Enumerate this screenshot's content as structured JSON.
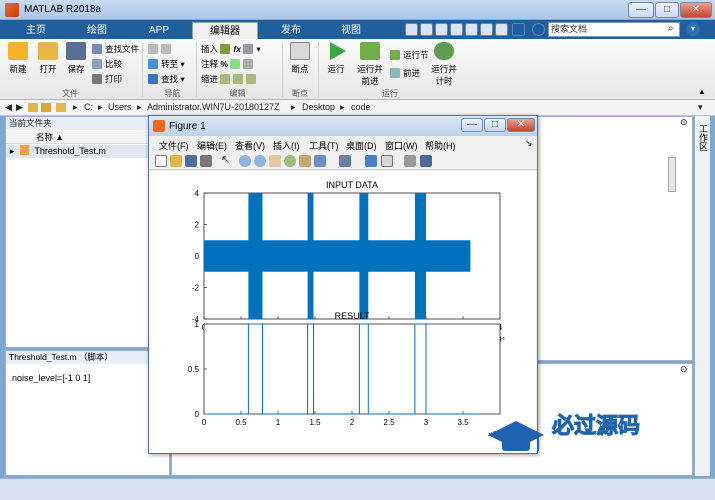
{
  "app": {
    "title": "MATLAB R2018a",
    "window_btns": [
      "—",
      "□",
      "✕"
    ]
  },
  "tabs": [
    "主页",
    "绘图",
    "APP",
    "编辑器",
    "发布",
    "视图"
  ],
  "search_placeholder": "搜索文档",
  "ribbon": {
    "file": {
      "new": "新建",
      "open": "打开",
      "save": "保存",
      "find_files": "查找文件",
      "compare": "比较",
      "print": "打印",
      "group": "文件"
    },
    "nav": {
      "goto": "转至",
      "find": "查找",
      "group": "导航"
    },
    "edit": {
      "insert": "插入",
      "comment": "注释",
      "indent": "缩进",
      "fx": "fx",
      "group": "编辑"
    },
    "breakpoint": {
      "label": "断点",
      "group": "断点"
    },
    "run": {
      "run": "运行",
      "run_advance": "运行并\n前进",
      "run_section": "运行节",
      "advance": "前进",
      "run_time": "运行并\n计时",
      "group": "运行"
    }
  },
  "address": [
    "C:",
    "Users",
    "Administrator.WIN7U-20180127Z",
    "Desktop",
    "code"
  ],
  "current_folder": {
    "title": "当前文件夹",
    "col_name": "名称 ▲",
    "file": "Threshold_Test.m"
  },
  "details": {
    "title": "Threshold_Test.m （脚本）",
    "line": "noise_level=[-1 0 1]"
  },
  "figure": {
    "title": "Figure 1",
    "menu": [
      "文件(F)",
      "编辑(E)",
      "查看(V)",
      "插入(I)",
      "工具(T)",
      "桌面(D)",
      "窗口(W)",
      "帮助(H)"
    ]
  },
  "right_strip_label": "工作区",
  "watermark": {
    "main": "必过源码",
    "sub": "Biguo100.com"
  },
  "colors": {
    "tabbar": "#1f5f9e",
    "accent": "#0072bd"
  },
  "chart_data": [
    {
      "type": "line",
      "title": "INPUT DATA",
      "xlim": [
        0,
        40000
      ],
      "ylim": [
        -4,
        4
      ],
      "xticks": [
        "0",
        "0.5",
        "1",
        "1.5",
        "2",
        "2.5",
        "3",
        "3.5",
        "4"
      ],
      "yticks": [
        "4",
        "2",
        "0",
        "-2",
        "-4"
      ],
      "x_exponent": "×10⁴",
      "series": [
        {
          "bursts": [
            [
              6000,
              7900
            ],
            [
              14000,
              14800
            ],
            [
              21000,
              22200
            ],
            [
              28500,
              30000
            ]
          ],
          "noise_band": [
            -1,
            1
          ],
          "signal_end": 36000
        }
      ]
    },
    {
      "type": "line",
      "title": "RESULT",
      "xlim": [
        0,
        40000
      ],
      "ylim": [
        0,
        1
      ],
      "xticks": [
        "0",
        "0.5",
        "1",
        "1.5",
        "2",
        "2.5",
        "3",
        "3.5"
      ],
      "yticks": [
        "1",
        "0.5",
        "0"
      ],
      "x_exponent": "×10⁴",
      "series": [
        {
          "pulses": [
            [
              6000,
              7900
            ],
            [
              14000,
              14800
            ],
            [
              21000,
              22200
            ],
            [
              28500,
              30000
            ]
          ]
        }
      ]
    }
  ]
}
